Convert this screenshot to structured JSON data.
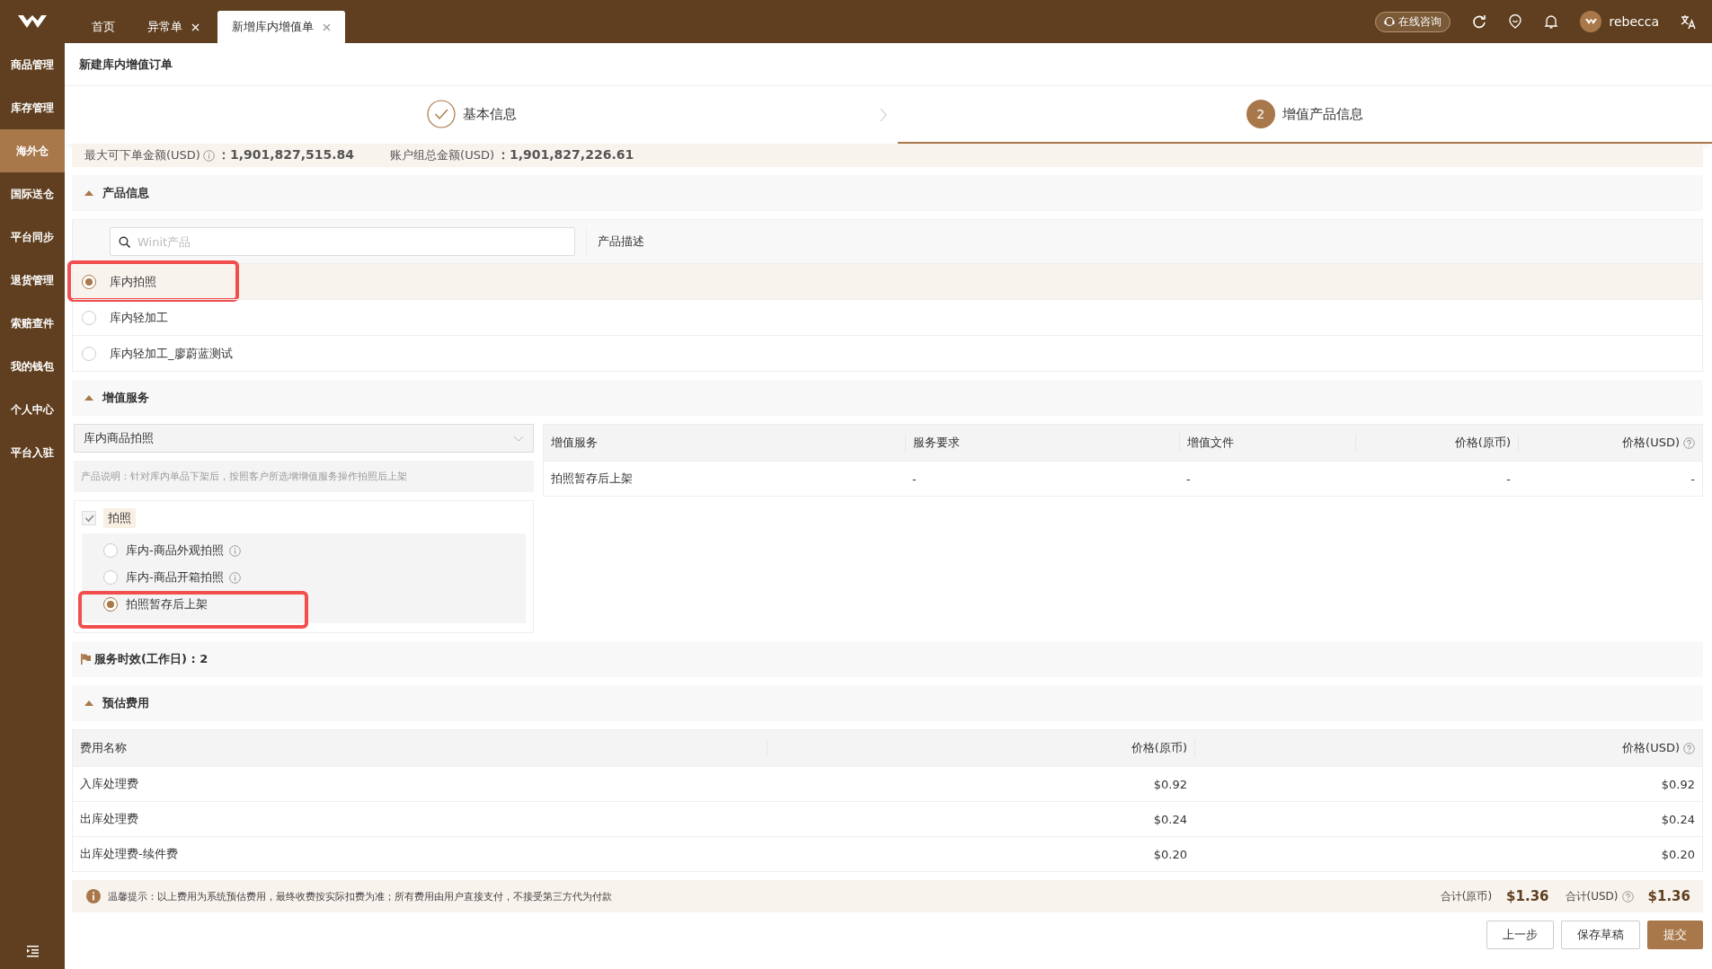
{
  "top_bar": {
    "tabs": [
      {
        "label": "首页",
        "closable": false,
        "selected": false
      },
      {
        "label": "异常单",
        "closable": true,
        "selected": false
      },
      {
        "label": "新增库内增值单",
        "closable": true,
        "selected": true
      }
    ],
    "consult_button": "在线咨询",
    "user_name": "rebecca"
  },
  "sidebar": {
    "items": [
      {
        "label": "商品管理",
        "selected": false
      },
      {
        "label": "库存管理",
        "selected": false
      },
      {
        "label": "海外仓",
        "selected": true
      },
      {
        "label": "国际送仓",
        "selected": false
      },
      {
        "label": "平台同步",
        "selected": false
      },
      {
        "label": "退货管理",
        "selected": false
      },
      {
        "label": "索赔查件",
        "selected": false
      },
      {
        "label": "我的钱包",
        "selected": false
      },
      {
        "label": "个人中心",
        "selected": false
      },
      {
        "label": "平台入驻",
        "selected": false
      }
    ]
  },
  "page_title": "新建库内增值订单",
  "steps": [
    {
      "label": "基本信息",
      "completed": true,
      "selected": false
    },
    {
      "number": "2",
      "label": "增值产品信息",
      "completed": false,
      "selected": true
    }
  ],
  "balance": [
    {
      "label": "最大可下单金额(USD)",
      "info": true,
      "value": "：1,901,827,515.84"
    },
    {
      "label": "账户组总金额(USD)",
      "info": false,
      "value": "：1,901,827,226.61"
    }
  ],
  "product_info": {
    "title": "产品信息",
    "expanded": true,
    "search_placeholder": "Winit产品",
    "description_header": "产品描述",
    "products": [
      {
        "name": "库内拍照",
        "selected": true,
        "highlighted": true
      },
      {
        "name": "库内轻加工",
        "selected": false,
        "highlighted": false
      },
      {
        "name": "库内轻加工_廖蔚蓝测试",
        "selected": false,
        "highlighted": false
      }
    ]
  },
  "value_services": {
    "title": "增值服务",
    "expanded": true,
    "service_select": "库内商品拍照",
    "description": "产品说明：针对库内单品下架后，按照客户所选增增值服务操作拍照后上架",
    "group": {
      "label": "拍照",
      "checked": true,
      "options": [
        {
          "label": "库内-商品外观拍照",
          "info": true,
          "selected": false,
          "highlighted": false
        },
        {
          "label": "库内-商品开箱拍照",
          "info": true,
          "selected": false,
          "highlighted": false
        },
        {
          "label": "拍照暂存后上架",
          "info": false,
          "selected": true,
          "highlighted": true
        }
      ]
    },
    "table": {
      "columns": [
        {
          "label": "增值服务",
          "help": false
        },
        {
          "label": "服务要求",
          "help": false
        },
        {
          "label": "增值文件",
          "help": false
        },
        {
          "label": "价格(原币)",
          "help": false
        },
        {
          "label": "价格(USD)",
          "help": true
        }
      ],
      "rows": [
        [
          "拍照暂存后上架",
          "-",
          "-",
          "-",
          "-"
        ]
      ]
    }
  },
  "service_time": "服务时效(工作日) : 2",
  "fees": {
    "title": "预估费用",
    "expanded": true,
    "columns": [
      {
        "label": "费用名称",
        "help": false
      },
      {
        "label": "价格(原币)",
        "help": false
      },
      {
        "label": "价格(USD)",
        "help": true
      }
    ],
    "rows": [
      [
        "入库处理费",
        "$0.92",
        "$0.92"
      ],
      [
        "出库处理费",
        "$0.24",
        "$0.24"
      ],
      [
        "出库处理费-续件费",
        "$0.20",
        "$0.20"
      ]
    ],
    "tip": "温馨提示：以上费用为系统预估费用，最终收费按实际扣费为准；所有费用由用户直接支付，不接受第三方代为付款",
    "totals": [
      {
        "label": "合计(原币)",
        "help": false,
        "value": "$1.36"
      },
      {
        "label": "合计(USD)",
        "help": true,
        "value": "$1.36"
      }
    ]
  },
  "buttons": [
    {
      "label": "上一步",
      "primary": false
    },
    {
      "label": "保存草稿",
      "primary": false
    },
    {
      "label": "提交",
      "primary": true
    }
  ]
}
